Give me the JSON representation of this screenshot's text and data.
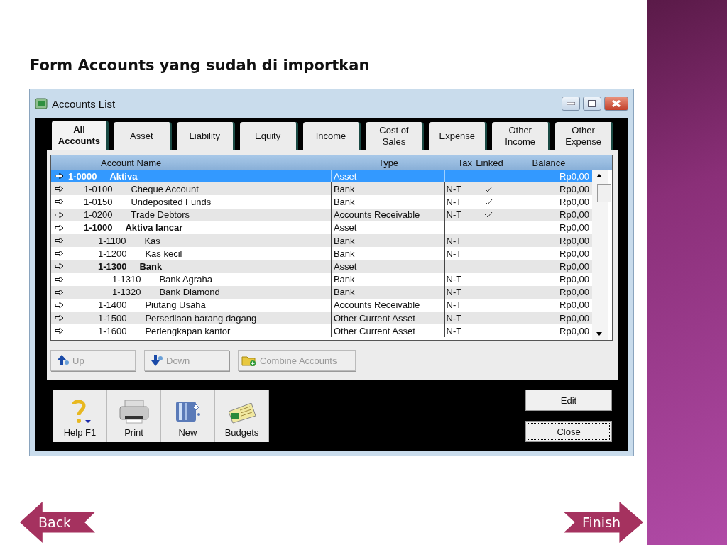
{
  "slide_title": "Form Accounts yang sudah di importkan",
  "window": {
    "title": "Accounts List"
  },
  "tabs": [
    {
      "label": "All\nAccounts",
      "selected": true
    },
    {
      "label": "Asset",
      "selected": false
    },
    {
      "label": "Liability",
      "selected": false
    },
    {
      "label": "Equity",
      "selected": false
    },
    {
      "label": "Income",
      "selected": false
    },
    {
      "label": "Cost of\nSales",
      "selected": false
    },
    {
      "label": "Expense",
      "selected": false
    },
    {
      "label": "Other\nIncome",
      "selected": false
    },
    {
      "label": "Other\nExpense",
      "selected": false
    }
  ],
  "table": {
    "columns": [
      "Account Name",
      "Type",
      "Tax",
      "Linked",
      "Balance"
    ],
    "rows": [
      {
        "kind": "header",
        "number": "1-0000",
        "name": "Aktiva",
        "type": "Asset",
        "linked": false,
        "balance": "Rp0,00",
        "selected": true,
        "children": [
          {
            "kind": "detail",
            "number": "1-0100",
            "name": "Cheque Account",
            "type": "Bank",
            "tax": "N-T",
            "linked": true,
            "balance": "Rp0,00",
            "selected": false
          },
          {
            "kind": "detail",
            "number": "1-0150",
            "name": "Undeposited Funds",
            "type": "Bank",
            "tax": "N-T",
            "linked": true,
            "balance": "Rp0,00",
            "selected": false
          },
          {
            "kind": "detail",
            "number": "1-0200",
            "name": "Trade Debtors",
            "type": "Accounts Receivable",
            "tax": "N-T",
            "linked": true,
            "balance": "Rp0,00",
            "selected": false
          },
          {
            "kind": "header",
            "number": "1-1000",
            "name": "Aktiva lancar",
            "type": "Asset",
            "linked": false,
            "balance": "Rp0,00",
            "selected": false,
            "children": [
              {
                "kind": "detail",
                "number": "1-1100",
                "name": "Kas",
                "type": "Bank",
                "tax": "N-T",
                "linked": false,
                "balance": "Rp0,00",
                "selected": false
              },
              {
                "kind": "detail",
                "number": "1-1200",
                "name": "Kas kecil",
                "type": "Bank",
                "tax": "N-T",
                "linked": false,
                "balance": "Rp0,00",
                "selected": false
              },
              {
                "kind": "header",
                "number": "1-1300",
                "name": "Bank",
                "type": "Asset",
                "linked": false,
                "balance": "Rp0,00",
                "selected": false,
                "children": [
                  {
                    "kind": "detail",
                    "number": "1-1310",
                    "name": "Bank Agraha",
                    "type": "Bank",
                    "tax": "N-T",
                    "linked": false,
                    "balance": "Rp0,00",
                    "selected": false
                  },
                  {
                    "kind": "detail",
                    "number": "1-1320",
                    "name": "Bank Diamond",
                    "type": "Bank",
                    "tax": "N-T",
                    "linked": false,
                    "balance": "Rp0,00",
                    "selected": false
                  }
                ]
              },
              {
                "kind": "detail",
                "number": "1-1400",
                "name": "Piutang Usaha",
                "type": "Accounts Receivable",
                "tax": "N-T",
                "linked": false,
                "balance": "Rp0,00",
                "selected": false
              },
              {
                "kind": "detail",
                "number": "1-1500",
                "name": "Persediaan barang dagang",
                "type": "Other Current Asset",
                "tax": "N-T",
                "linked": false,
                "balance": "Rp0,00",
                "selected": false
              },
              {
                "kind": "detail",
                "number": "1-1600",
                "name": "Perlengkapan kantor",
                "type": "Other Current Asset",
                "tax": "N-T",
                "linked": false,
                "balance": "Rp0,00",
                "selected": false
              }
            ]
          }
        ]
      }
    ]
  },
  "list_buttons": [
    {
      "kind": "up",
      "label": "Up",
      "disabled": true
    },
    {
      "kind": "down",
      "label": "Down",
      "disabled": true
    },
    {
      "kind": "combine",
      "label": "Combine Accounts",
      "disabled": true
    }
  ],
  "toolbar": [
    {
      "kind": "help",
      "label": "Help F1"
    },
    {
      "kind": "print",
      "label": "Print"
    },
    {
      "kind": "new",
      "label": "New"
    },
    {
      "kind": "budgets",
      "label": "Budgets"
    }
  ],
  "actions": [
    "Edit",
    "Close"
  ],
  "nav": [
    {
      "kind": "back",
      "label": "Back"
    },
    {
      "kind": "forward",
      "label": "Finish"
    }
  ]
}
